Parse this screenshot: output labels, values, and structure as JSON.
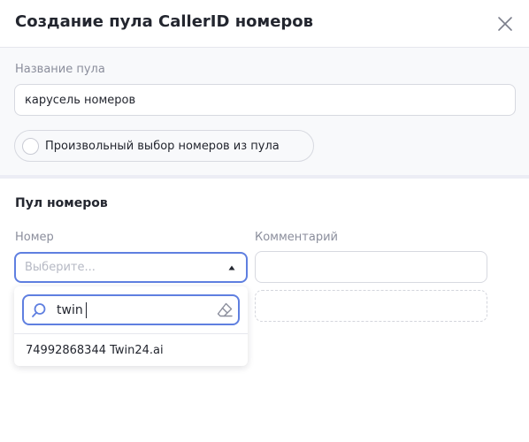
{
  "modal": {
    "title": "Создание пула CallerID номеров"
  },
  "pool_name": {
    "label": "Название пула",
    "value": "карусель номеров"
  },
  "random_choice": {
    "label": "Произвольный выбор номеров из пула",
    "checked": false
  },
  "pool_section": {
    "title": "Пул номеров",
    "number_label": "Номер",
    "comment_label": "Комментарий",
    "select_placeholder": "Выберите...",
    "comment_value": ""
  },
  "dropdown": {
    "search_value": "twin",
    "options": [
      {
        "label": "74992868344 Twin24.ai"
      }
    ]
  },
  "icons": {
    "close": "close-icon",
    "caret": "caret-up-icon",
    "search": "search-icon",
    "clear": "eraser-icon",
    "radio": "radio-circle"
  },
  "colors": {
    "accent": "#5f7fe0",
    "text": "#23262f",
    "muted": "#8b8e9c",
    "border": "#d7d9e0",
    "section_bg": "#f8f9fb"
  }
}
